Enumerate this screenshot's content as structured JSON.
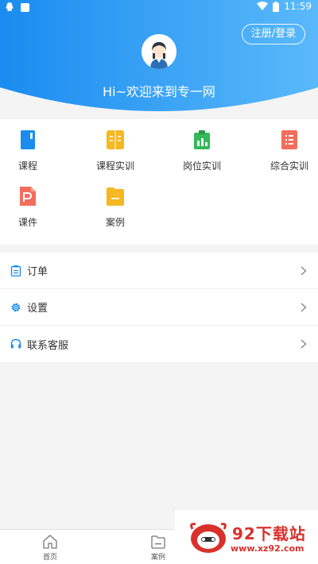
{
  "status_bar": {
    "time": "11:59"
  },
  "header": {
    "login_label": "注册/登录",
    "greeting": "Hi~欢迎来到专一网"
  },
  "grid": [
    {
      "label": "课程",
      "icon": "course-book-icon",
      "color": "#1a8cf0"
    },
    {
      "label": "课程实训",
      "icon": "open-book-icon",
      "color": "#f5b820"
    },
    {
      "label": "岗位实训",
      "icon": "clipboard-chart-icon",
      "color": "#34b85a"
    },
    {
      "label": "综合实训",
      "icon": "list-document-icon",
      "color": "#f26d5b"
    },
    {
      "label": "课件",
      "icon": "ppt-document-icon",
      "color": "#f26d5b"
    },
    {
      "label": "案例",
      "icon": "folder-icon",
      "color": "#f5b820"
    }
  ],
  "menu": [
    {
      "label": "订单",
      "icon": "order-list-icon"
    },
    {
      "label": "设置",
      "icon": "gear-icon"
    },
    {
      "label": "联系客服",
      "icon": "headset-icon"
    }
  ],
  "tabs": [
    {
      "label": "首页",
      "icon": "home-icon"
    },
    {
      "label": "案例",
      "icon": "folder-icon"
    }
  ],
  "watermark": {
    "name": "92下载站",
    "url": "www.xz92.com"
  },
  "colors": {
    "primary": "#1a8cf0",
    "header_light": "#5ab9fa"
  }
}
